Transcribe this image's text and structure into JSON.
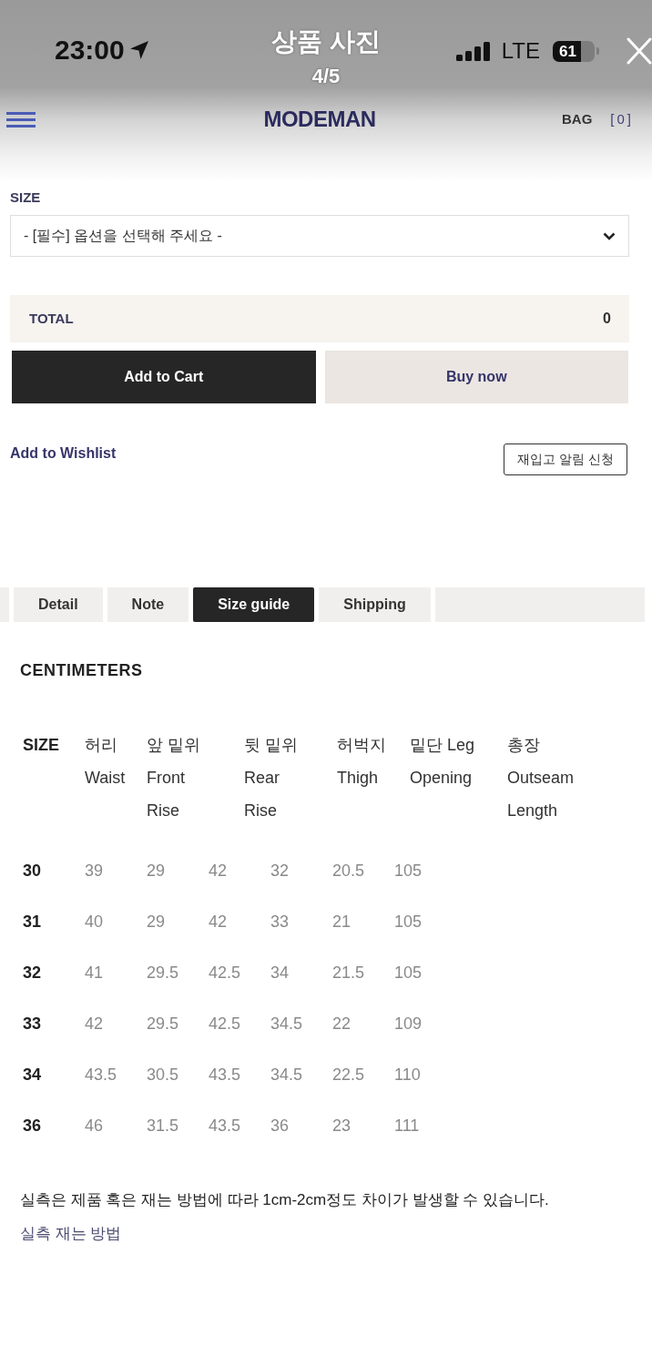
{
  "status_bar": {
    "time": "23:00",
    "title": "상품 사진",
    "counter": "4/5",
    "network": "LTE",
    "battery": "61"
  },
  "nav": {
    "logo": "MODEMAN",
    "bag_label": "BAG",
    "bag_count": "[0]"
  },
  "product_form": {
    "size_label": "SIZE",
    "size_select": {
      "value": "- [필수] 옵션을 선택해 주세요 -"
    },
    "total_label": "TOTAL",
    "total_value": "0",
    "buttons": [
      {
        "label": "Add to Cart",
        "kind": "cart"
      },
      {
        "label": "Buy now",
        "kind": "buy"
      }
    ],
    "wishlist": "Add to Wishlist",
    "restock_button": "재입고 알림 신청"
  },
  "tabs": [
    {
      "label": "Detail",
      "selected": false
    },
    {
      "label": "Note",
      "selected": false
    },
    {
      "label": "Size guide",
      "selected": true
    },
    {
      "label": "Shipping",
      "selected": false
    }
  ],
  "size_guide": {
    "unit": "CENTIMETERS",
    "header_table": {
      "cells": [
        {
          "lines": [
            "SIZE"
          ]
        },
        {
          "lines": [
            "허리",
            "Waist"
          ]
        },
        {
          "lines": [
            "앞 밑위",
            "Front",
            "Rise"
          ]
        },
        {
          "lines": [
            "뒷 밑위",
            "Rear",
            "Rise"
          ]
        },
        {
          "lines": [
            "허벅지",
            "Thigh"
          ]
        },
        {
          "lines": [
            "밑단 Leg",
            "Opening"
          ]
        },
        {
          "lines": [
            "총장",
            "Outseam",
            "Length"
          ]
        }
      ]
    },
    "measurements_table": {
      "rows": [
        [
          "30",
          "39",
          "29",
          "42",
          "32",
          "20.5",
          "105"
        ],
        [
          "31",
          "40",
          "29",
          "42",
          "33",
          "21",
          "105"
        ],
        [
          "32",
          "41",
          "29.5",
          "42.5",
          "34",
          "21.5",
          "105"
        ],
        [
          "33",
          "42",
          "29.5",
          "42.5",
          "34.5",
          "22",
          "109"
        ],
        [
          "34",
          "43.5",
          "30.5",
          "43.5",
          "34.5",
          "22.5",
          "110"
        ],
        [
          "36",
          "46",
          "31.5",
          "43.5",
          "36",
          "23",
          "111"
        ]
      ]
    },
    "note": "실측은 제품 혹은 재는 방법에 따라 1cm-2cm정도 차이가 발생할 수 있습니다.",
    "link": "실측 재는 방법"
  }
}
